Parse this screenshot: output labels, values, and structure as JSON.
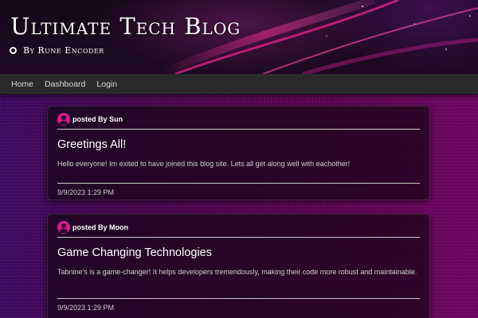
{
  "site": {
    "title": "Ultimate Tech Blog",
    "byline": "By Rune Encoder"
  },
  "nav": {
    "items": [
      {
        "label": "Home"
      },
      {
        "label": "Dashboard"
      },
      {
        "label": "Login"
      }
    ]
  },
  "posts": [
    {
      "posted_by": "posted By Sun",
      "title": "Greetings All!",
      "body": "Hello everyone! Im exited to have joined this blog site. Lets all get along well with eachother!",
      "date": "9/9/2023 1:29 PM"
    },
    {
      "posted_by": "posted By Moon",
      "title": "Game Changing Technologies",
      "body": "Tabnine's is a game-changer! It helps developers tremendously, making their code more robust and maintainable.",
      "date": "9/9/2023 1:29 PM"
    }
  ],
  "colors": {
    "accent": "#d81b8c",
    "nav_bg": "#2a2a2c",
    "page_gradient_start": "#3a0a5e",
    "page_gradient_end": "#6b0560"
  },
  "icons": {
    "byline_icon": "github-icon",
    "avatar": "user-avatar-icon"
  }
}
